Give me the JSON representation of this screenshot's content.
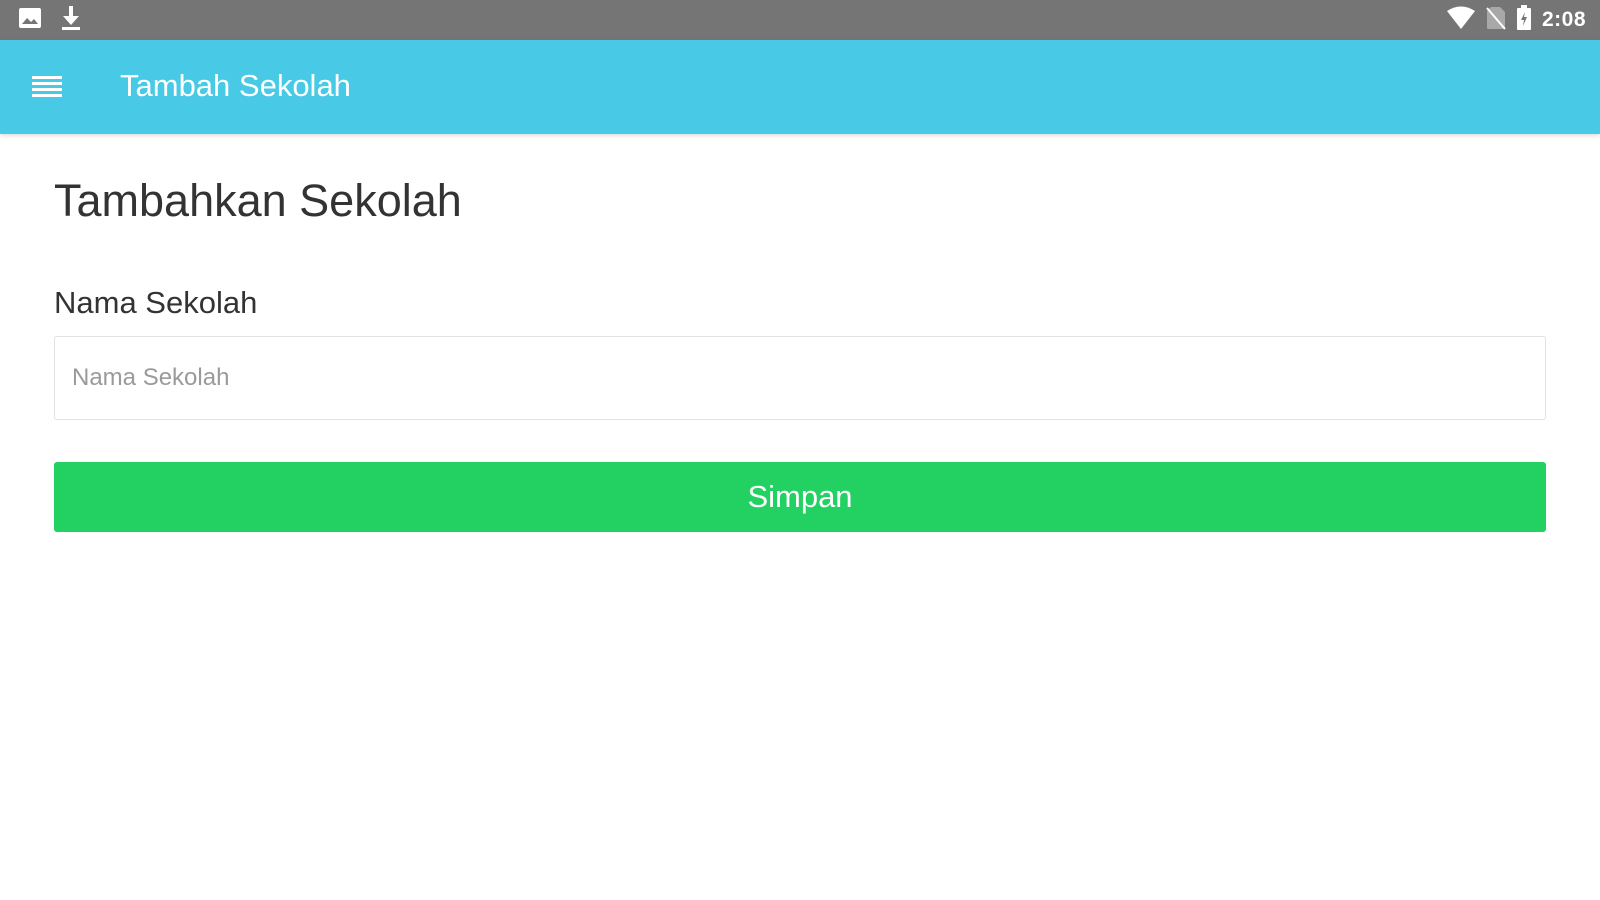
{
  "status_bar": {
    "time": "2:08",
    "left_icons": [
      "image-icon",
      "download-icon"
    ],
    "right_icons": [
      "wifi-icon",
      "no-sim-icon",
      "battery-icon"
    ]
  },
  "app_bar": {
    "menu_icon": "menu-icon",
    "title": "Tambah Sekolah"
  },
  "form": {
    "heading": "Tambahkan Sekolah",
    "school_name_label": "Nama Sekolah",
    "school_name_value": "",
    "school_name_placeholder": "Nama Sekolah",
    "save_label": "Simpan"
  },
  "colors": {
    "status_bar": "#757575",
    "app_bar": "#48c9e5",
    "save_button": "#22d162",
    "text": "#333333"
  }
}
